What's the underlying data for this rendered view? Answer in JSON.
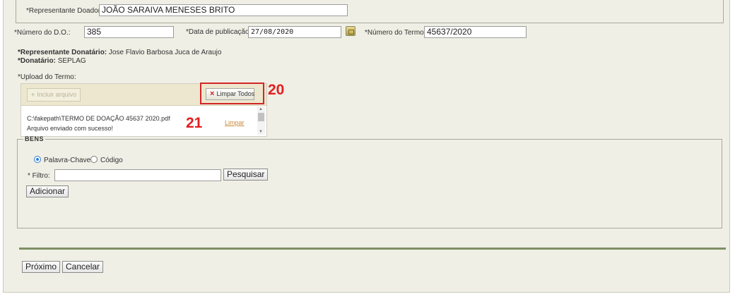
{
  "top": {
    "representante_doador_label": "*Representante Doador:",
    "representante_doador_value": "JOÃO SARAIVA MENESES BRITO"
  },
  "row1": {
    "numero_do_label": "*Número do D.O.:",
    "numero_do_value": "385",
    "data_pub_label": "*Data de publicação:",
    "data_pub_value": "27/08/2020",
    "numero_termo_label": "*Número do Termo:",
    "numero_termo_value": "45637/2020"
  },
  "info": {
    "rep_donatario_label": "*Representante Donatário:",
    "rep_donatario_value": "Jose Flavio Barbosa Juca de Araujo",
    "donatario_label": "*Donatário:",
    "donatario_value": "SEPLAG"
  },
  "upload": {
    "label": "*Upload do Termo:",
    "add_button": "Incluir arquivo",
    "clear_all_button": "Limpar Todos",
    "file_path": "C:\\fakepath\\TERMO DE DOAÇÃO 45637 2020.pdf",
    "file_status": "Arquivo enviado com sucesso!",
    "remove_link": "Limpar"
  },
  "annotations": {
    "a20": "20",
    "a21": "21",
    "color": "#e41f1f"
  },
  "bens": {
    "legend": "BENS",
    "radio_keyword": "Palavra-Chave",
    "radio_code": "Código",
    "selected": "Palavra-Chave",
    "filter_label": "* Filtro:",
    "filter_value": "",
    "search_button": "Pesquisar",
    "add_button": "Adicionar"
  },
  "footer": {
    "next_button": "Próximo",
    "cancel_button": "Cancelar"
  },
  "colors": {
    "page_bg": "#efefe5",
    "divider": "#7d8f64",
    "highlight": "#d32626",
    "link": "#c9893a"
  }
}
